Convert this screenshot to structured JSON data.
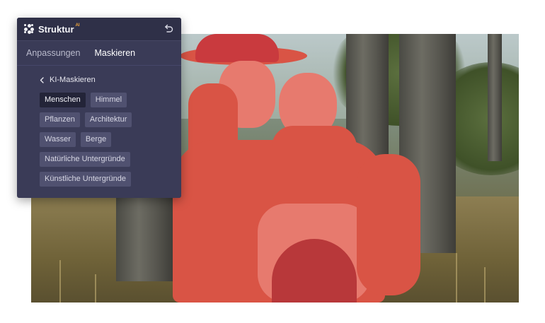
{
  "app": {
    "title": "Struktur",
    "badge": "AI"
  },
  "tabs": [
    {
      "label": "Anpassungen",
      "active": false
    },
    {
      "label": "Maskieren",
      "active": true
    }
  ],
  "section": {
    "back_label": "KI-Maskieren"
  },
  "chips": [
    {
      "label": "Menschen",
      "selected": true
    },
    {
      "label": "Himmel",
      "selected": false
    },
    {
      "label": "Pflanzen",
      "selected": false
    },
    {
      "label": "Architektur",
      "selected": false
    },
    {
      "label": "Wasser",
      "selected": false
    },
    {
      "label": "Berge",
      "selected": false
    },
    {
      "label": "Natürliche Untergründe",
      "selected": false
    },
    {
      "label": "Künstliche Untergründe",
      "selected": false
    }
  ],
  "colors": {
    "panel_bg": "#3a3b57",
    "mask": "#d95445",
    "accent": "#f0a53c"
  },
  "icons": {
    "app": "struktur-logo-icon",
    "undo": "undo-icon",
    "back": "chevron-left-icon"
  }
}
